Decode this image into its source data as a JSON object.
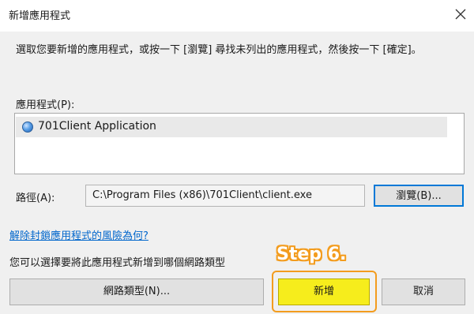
{
  "window": {
    "title": "新增應用程式"
  },
  "instructions": "選取您要新增的應用程式，或按一下 [瀏覽] 尋找未列出的應用程式，然後按一下 [確定]。",
  "apps_label": "應用程式(P):",
  "apps_list": [
    {
      "name": "701Client Application",
      "icon": "globe-app-icon"
    }
  ],
  "path": {
    "label": "路徑(A):",
    "value": "C:\\Program Files (x86)\\701Client\\client.exe"
  },
  "buttons": {
    "browse": "瀏覽(B)...",
    "network_types": "網路類型(N)...",
    "add": "新增",
    "cancel": "取消"
  },
  "risk_link": "解除封鎖應用程式的風險為何?",
  "network_note": "您可以選擇要將此應用程式新增到哪個網路類型",
  "annotation": {
    "step": "Step 6."
  },
  "colors": {
    "highlight": "#f39c1e",
    "add_button": "#f6ed1c",
    "link": "#0066cc",
    "focus": "#0078d7"
  }
}
